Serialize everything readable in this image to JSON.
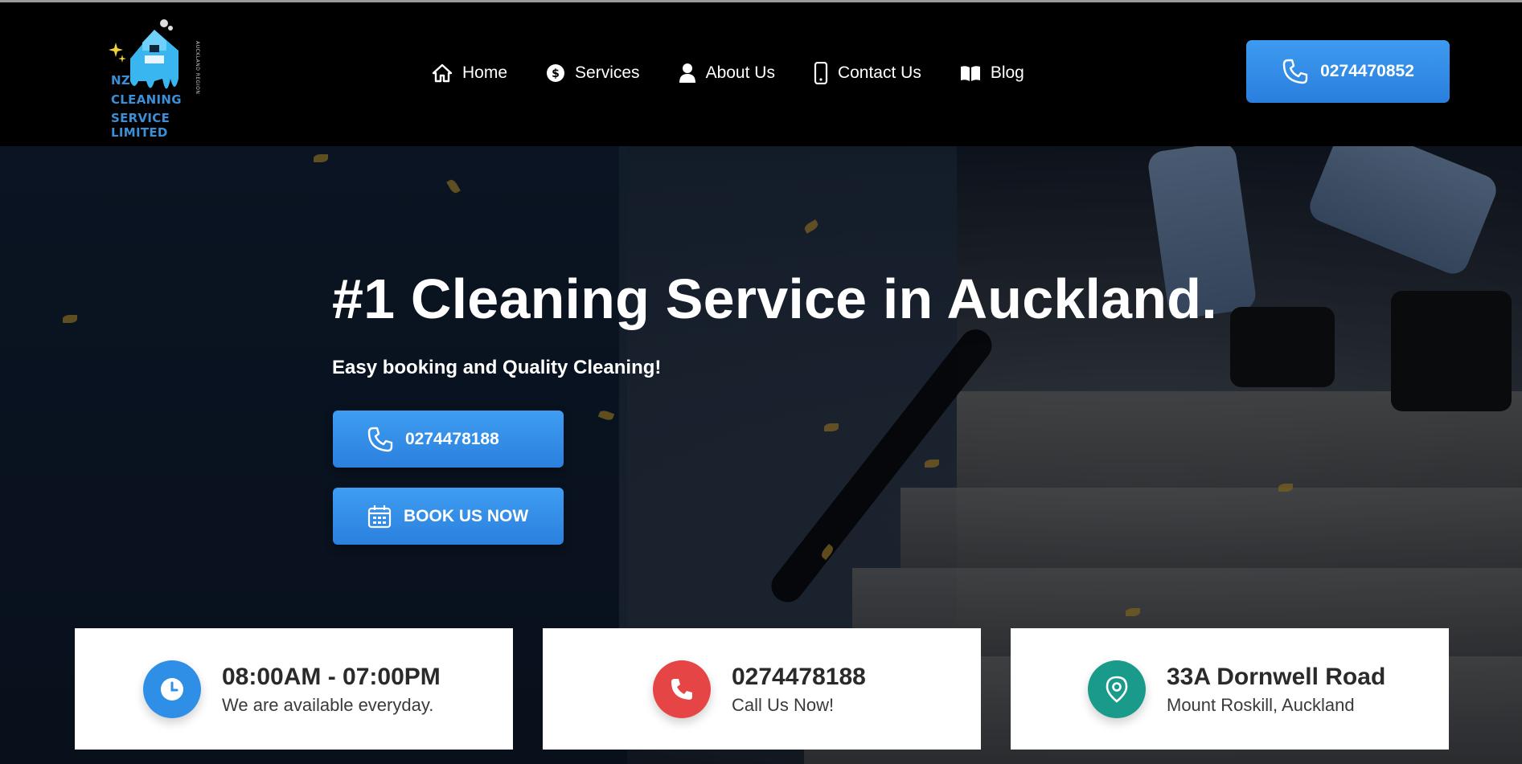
{
  "logo": {
    "line1": "NZ",
    "line2": "CLEANING",
    "line3": "SERVICE LIMITED",
    "region": "AUCKLAND REGION"
  },
  "nav": [
    {
      "label": "Home",
      "icon": "home-icon"
    },
    {
      "label": "Services",
      "icon": "dollar-icon"
    },
    {
      "label": "About Us",
      "icon": "user-icon"
    },
    {
      "label": "Contact Us",
      "icon": "mobile-phone-icon"
    },
    {
      "label": "Blog",
      "icon": "book-icon"
    }
  ],
  "header_phone": "0274470852",
  "hero": {
    "title": "#1 Cleaning Service in Auckland.",
    "subtitle": "Easy booking and Quality Cleaning!",
    "call_button": "0274478188",
    "book_button": "BOOK US NOW"
  },
  "cards": [
    {
      "title": "08:00AM - 07:00PM",
      "subtitle": "We are available everyday.",
      "icon": "clock-icon",
      "color": "#2f8ee6"
    },
    {
      "title": "0274478188",
      "subtitle": "Call Us Now!",
      "icon": "phone-icon",
      "color": "#e64545"
    },
    {
      "title": "33A Dornwell Road",
      "subtitle": "Mount Roskill, Auckland",
      "icon": "location-pin-icon",
      "color": "#1a9a8a"
    }
  ],
  "colors": {
    "accent_blue": "#2f8ee6",
    "header_bg": "#000000"
  }
}
